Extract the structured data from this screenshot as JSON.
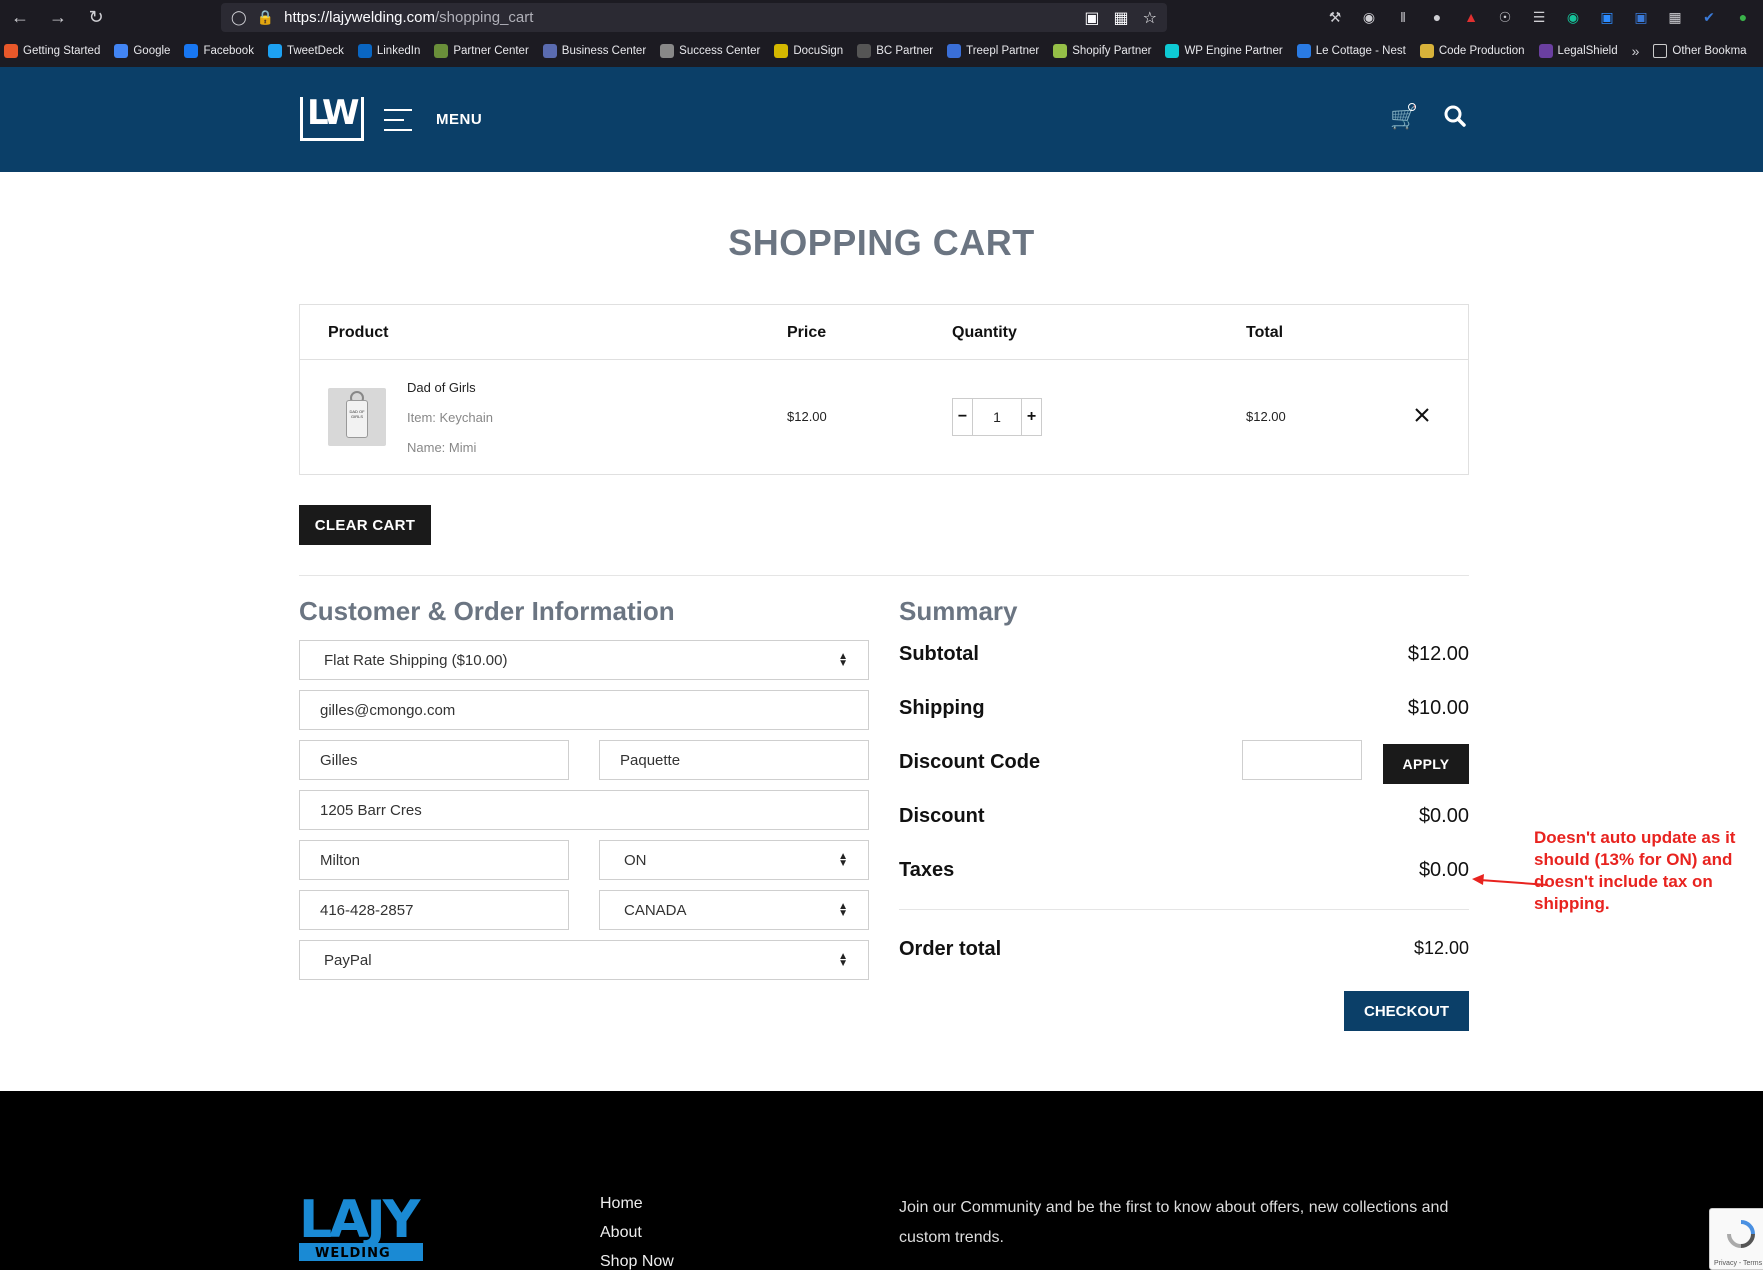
{
  "browser": {
    "url_host": "https://lajywelding.com",
    "url_path": "/shopping_cart",
    "bookmarks": [
      {
        "label": "Getting Started",
        "color": "#e8582a"
      },
      {
        "label": "Google",
        "color": "#4285f4"
      },
      {
        "label": "Facebook",
        "color": "#1877f2"
      },
      {
        "label": "TweetDeck",
        "color": "#1da1f2"
      },
      {
        "label": "LinkedIn",
        "color": "#0a66c2"
      },
      {
        "label": "Partner Center",
        "color": "#6a8f3a"
      },
      {
        "label": "Business Center",
        "color": "#5a6bb0"
      },
      {
        "label": "Success Center",
        "color": "#888888"
      },
      {
        "label": "DocuSign",
        "color": "#d4b800"
      },
      {
        "label": "BC Partner",
        "color": "#555555"
      },
      {
        "label": "Treepl Partner",
        "color": "#3a6fd8"
      },
      {
        "label": "Shopify Partner",
        "color": "#95bf47"
      },
      {
        "label": "WP Engine Partner",
        "color": "#0ecad4"
      },
      {
        "label": "Le Cottage - Nest",
        "color": "#2a7be4"
      },
      {
        "label": "Code Production",
        "color": "#d8b23a"
      },
      {
        "label": "LegalShield",
        "color": "#6a3fa0"
      }
    ],
    "other_bookmarks": "Other Bookma"
  },
  "header": {
    "menu_label": "MENU"
  },
  "page": {
    "title": "SHOPPING CART"
  },
  "cart": {
    "columns": {
      "product": "Product",
      "price": "Price",
      "quantity": "Quantity",
      "total": "Total"
    },
    "items": [
      {
        "name": "Dad of Girls",
        "item_line": "Item:  Keychain",
        "name_line": "Name:  Mimi",
        "price": "$12.00",
        "quantity": "1",
        "total": "$12.00",
        "thumb_text": "DAD OF GIRLS"
      }
    ],
    "clear_label": "CLEAR CART"
  },
  "customer": {
    "title": "Customer & Order Information",
    "shipping_method": "Flat Rate Shipping ($10.00)",
    "email": "gilles@cmongo.com",
    "first_name": "Gilles",
    "last_name": "Paquette",
    "address": "1205 Barr Cres",
    "city": "Milton",
    "province": "ON",
    "phone": "416-428-2857",
    "country": "CANADA",
    "payment": "PayPal"
  },
  "summary": {
    "title": "Summary",
    "subtotal_label": "Subtotal",
    "subtotal": "$12.00",
    "shipping_label": "Shipping",
    "shipping": "$10.00",
    "discount_code_label": "Discount Code",
    "apply_label": "APPLY",
    "discount_label": "Discount",
    "discount": "$0.00",
    "taxes_label": "Taxes",
    "taxes": "$0.00",
    "order_total_label": "Order total",
    "order_total": "$12.00",
    "checkout_label": "CHECKOUT"
  },
  "annotation": {
    "text": "Doesn't auto update as it should (13% for ON) and doesn't include tax on shipping.",
    "color": "#e8231f"
  },
  "footer": {
    "links": [
      "Home",
      "About",
      "Shop Now"
    ],
    "newsletter_text": "Join our Community and be the first to know about offers, new collections and custom trends.",
    "logo_text": "LAJY",
    "logo_sub": "WELDING"
  },
  "recaptcha": {
    "text": "Privacy - Terms"
  },
  "colors": {
    "header_bg": "#0b3f68",
    "title_gray": "#6b7582",
    "button_dark": "#1a1a1a",
    "checkout_bg": "#0b3f68",
    "logo_blue": "#1a8ad4"
  }
}
